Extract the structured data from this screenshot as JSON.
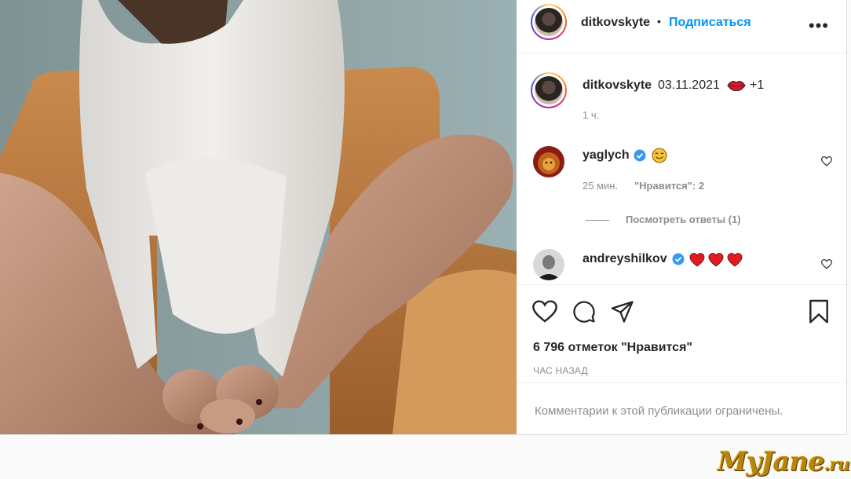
{
  "header": {
    "username": "ditkovskyte",
    "separator": "•",
    "follow_label": "Подписаться",
    "more_icon": "more-horizontal-icon",
    "more_label": "•••"
  },
  "caption": {
    "username": "ditkovskyte",
    "text": "03.11.2021",
    "emoji": "lips-emoji",
    "extra": "+1",
    "time": "1 ч."
  },
  "comments": [
    {
      "username": "yaglych",
      "verified": true,
      "emoji": "smiling-face-emoji",
      "time": "25 мин.",
      "likes": "\"Нравится\": 2",
      "replies_label": "Посмотреть ответы (1)"
    },
    {
      "username": "andreyshilkov",
      "verified": true,
      "emoji": "three-red-hearts-emoji"
    }
  ],
  "actions": {
    "like_icon": "heart-icon",
    "comment_icon": "comment-bubble-icon",
    "share_icon": "paper-plane-icon",
    "save_icon": "bookmark-icon"
  },
  "likes_text": "6 796 отметок \"Нравится\"",
  "post_time": "ЧАС НАЗАД",
  "comments_restricted": "Комментарии к этой публикации ограничены.",
  "watermark": {
    "main": "MyJane",
    "suffix": ".ru"
  },
  "colors": {
    "link_blue": "#0095f6",
    "verified_blue": "#3897f0",
    "heart_red": "#ed4956",
    "text": "#262626",
    "muted": "#8e8e8e"
  }
}
